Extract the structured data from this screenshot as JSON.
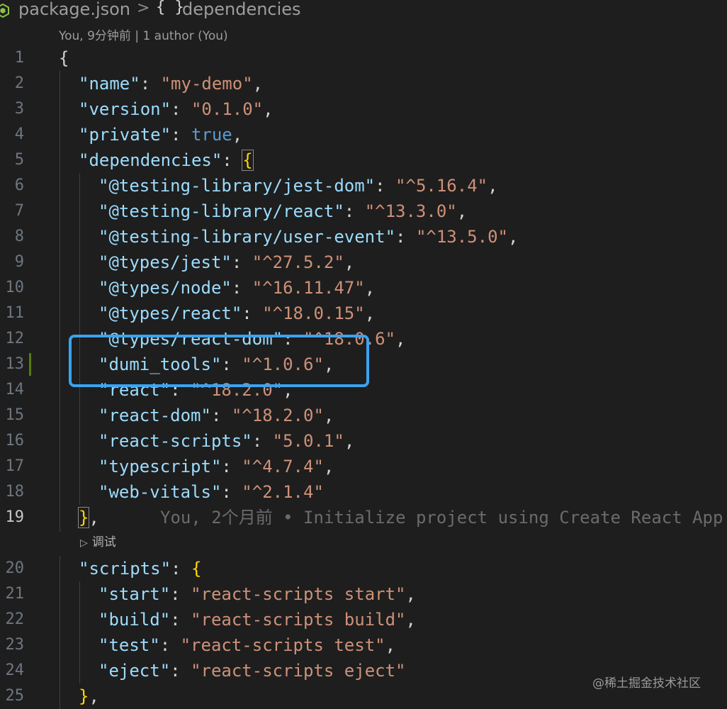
{
  "breadcrumb": {
    "file": "package.json",
    "separator": ">",
    "symbol_icon": "{ }",
    "symbol": "dependencies"
  },
  "codelens_top": "You, 9分钟前 | 1 author (You)",
  "lines": [
    {
      "num": "1",
      "parts": [
        {
          "t": "{",
          "c": "p"
        }
      ]
    },
    {
      "num": "2",
      "parts": [
        {
          "t": "\"name\"",
          "c": "k"
        },
        {
          "t": ": ",
          "c": "p"
        },
        {
          "t": "\"my-demo\"",
          "c": "s"
        },
        {
          "t": ",",
          "c": "p"
        }
      ]
    },
    {
      "num": "3",
      "parts": [
        {
          "t": "\"version\"",
          "c": "k"
        },
        {
          "t": ": ",
          "c": "p"
        },
        {
          "t": "\"0.1.0\"",
          "c": "s"
        },
        {
          "t": ",",
          "c": "p"
        }
      ]
    },
    {
      "num": "4",
      "parts": [
        {
          "t": "\"private\"",
          "c": "k"
        },
        {
          "t": ": ",
          "c": "p"
        },
        {
          "t": "true",
          "c": "b"
        },
        {
          "t": ",",
          "c": "p"
        }
      ]
    },
    {
      "num": "5",
      "parts": [
        {
          "t": "\"dependencies\"",
          "c": "k"
        },
        {
          "t": ": ",
          "c": "p"
        },
        {
          "t": "{",
          "c": "brace hl-brace"
        }
      ]
    },
    {
      "num": "6",
      "parts": [
        {
          "t": "\"@testing-library/jest-dom\"",
          "c": "k"
        },
        {
          "t": ": ",
          "c": "p"
        },
        {
          "t": "\"^5.16.4\"",
          "c": "s"
        },
        {
          "t": ",",
          "c": "p"
        }
      ]
    },
    {
      "num": "7",
      "parts": [
        {
          "t": "\"@testing-library/react\"",
          "c": "k"
        },
        {
          "t": ": ",
          "c": "p"
        },
        {
          "t": "\"^13.3.0\"",
          "c": "s"
        },
        {
          "t": ",",
          "c": "p"
        }
      ]
    },
    {
      "num": "8",
      "parts": [
        {
          "t": "\"@testing-library/user-event\"",
          "c": "k"
        },
        {
          "t": ": ",
          "c": "p"
        },
        {
          "t": "\"^13.5.0\"",
          "c": "s"
        },
        {
          "t": ",",
          "c": "p"
        }
      ]
    },
    {
      "num": "9",
      "parts": [
        {
          "t": "\"@types/jest\"",
          "c": "k"
        },
        {
          "t": ": ",
          "c": "p"
        },
        {
          "t": "\"^27.5.2\"",
          "c": "s"
        },
        {
          "t": ",",
          "c": "p"
        }
      ]
    },
    {
      "num": "10",
      "parts": [
        {
          "t": "\"@types/node\"",
          "c": "k"
        },
        {
          "t": ": ",
          "c": "p"
        },
        {
          "t": "\"^16.11.47\"",
          "c": "s"
        },
        {
          "t": ",",
          "c": "p"
        }
      ]
    },
    {
      "num": "11",
      "parts": [
        {
          "t": "\"@types/react\"",
          "c": "k"
        },
        {
          "t": ": ",
          "c": "p"
        },
        {
          "t": "\"^18.0.15\"",
          "c": "s"
        },
        {
          "t": ",",
          "c": "p"
        }
      ]
    },
    {
      "num": "12",
      "parts": [
        {
          "t": "\"@types/react-dom\"",
          "c": "k"
        },
        {
          "t": ": ",
          "c": "p"
        },
        {
          "t": "\"^18.0.6\"",
          "c": "s"
        },
        {
          "t": ",",
          "c": "p"
        }
      ]
    },
    {
      "num": "13",
      "parts": [
        {
          "t": "\"dumi_tools\"",
          "c": "k"
        },
        {
          "t": ": ",
          "c": "p"
        },
        {
          "t": "\"^1.0.6\"",
          "c": "s"
        },
        {
          "t": ",",
          "c": "p"
        }
      ]
    },
    {
      "num": "14",
      "parts": [
        {
          "t": "\"react\"",
          "c": "k"
        },
        {
          "t": ": ",
          "c": "p"
        },
        {
          "t": "\"^18.2.0\"",
          "c": "s"
        },
        {
          "t": ",",
          "c": "p"
        }
      ]
    },
    {
      "num": "15",
      "parts": [
        {
          "t": "\"react-dom\"",
          "c": "k"
        },
        {
          "t": ": ",
          "c": "p"
        },
        {
          "t": "\"^18.2.0\"",
          "c": "s"
        },
        {
          "t": ",",
          "c": "p"
        }
      ]
    },
    {
      "num": "16",
      "parts": [
        {
          "t": "\"react-scripts\"",
          "c": "k"
        },
        {
          "t": ": ",
          "c": "p"
        },
        {
          "t": "\"5.0.1\"",
          "c": "s"
        },
        {
          "t": ",",
          "c": "p"
        }
      ]
    },
    {
      "num": "17",
      "parts": [
        {
          "t": "\"typescript\"",
          "c": "k"
        },
        {
          "t": ": ",
          "c": "p"
        },
        {
          "t": "\"^4.7.4\"",
          "c": "s"
        },
        {
          "t": ",",
          "c": "p"
        }
      ]
    },
    {
      "num": "18",
      "parts": [
        {
          "t": "\"web-vitals\"",
          "c": "k"
        },
        {
          "t": ": ",
          "c": "p"
        },
        {
          "t": "\"^2.1.4\"",
          "c": "s"
        }
      ]
    },
    {
      "num": "19",
      "parts": [
        {
          "t": "}",
          "c": "brace hl-brace"
        },
        {
          "t": ",",
          "c": "p"
        }
      ]
    },
    {
      "num": "20",
      "parts": [
        {
          "t": "\"scripts\"",
          "c": "k"
        },
        {
          "t": ": ",
          "c": "p"
        },
        {
          "t": "{",
          "c": "brace"
        }
      ]
    },
    {
      "num": "21",
      "parts": [
        {
          "t": "\"start\"",
          "c": "k"
        },
        {
          "t": ": ",
          "c": "p"
        },
        {
          "t": "\"react-scripts start\"",
          "c": "s"
        },
        {
          "t": ",",
          "c": "p"
        }
      ]
    },
    {
      "num": "22",
      "parts": [
        {
          "t": "\"build\"",
          "c": "k"
        },
        {
          "t": ": ",
          "c": "p"
        },
        {
          "t": "\"react-scripts build\"",
          "c": "s"
        },
        {
          "t": ",",
          "c": "p"
        }
      ]
    },
    {
      "num": "23",
      "parts": [
        {
          "t": "\"test\"",
          "c": "k"
        },
        {
          "t": ": ",
          "c": "p"
        },
        {
          "t": "\"react-scripts test\"",
          "c": "s"
        },
        {
          "t": ",",
          "c": "p"
        }
      ]
    },
    {
      "num": "24",
      "parts": [
        {
          "t": "\"eject\"",
          "c": "k"
        },
        {
          "t": ": ",
          "c": "p"
        },
        {
          "t": "\"react-scripts eject\"",
          "c": "s"
        }
      ]
    },
    {
      "num": "25",
      "parts": [
        {
          "t": "}",
          "c": "brace"
        },
        {
          "t": ",",
          "c": "p"
        }
      ]
    }
  ],
  "blame": "You, 2个月前 • Initialize project using Create React App",
  "debug_lens": "调试",
  "watermark": "@稀土掘金技术社区",
  "colors": {
    "key": "#9cdcfe",
    "string": "#ce9178",
    "boolean": "#569cd6",
    "bracket": "#ffd700",
    "focus": "#3aa3f0"
  }
}
